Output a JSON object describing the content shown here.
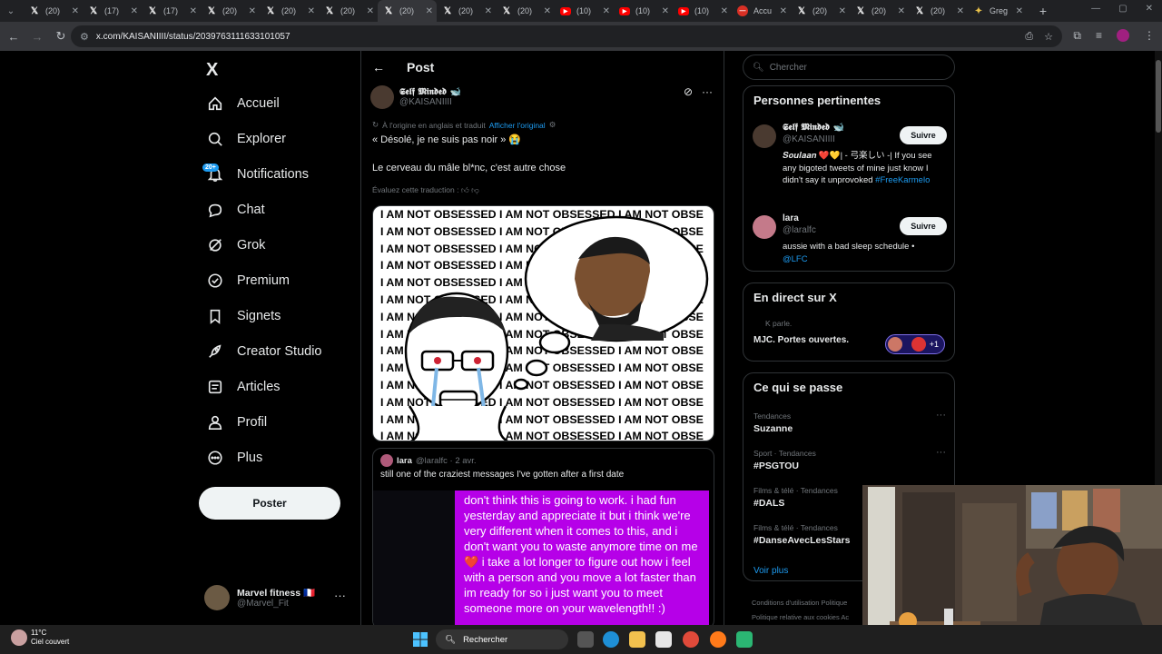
{
  "browser": {
    "tabs": [
      {
        "icon": "x-icon",
        "title": "(20)"
      },
      {
        "icon": "x-icon",
        "title": "(17)"
      },
      {
        "icon": "x-icon",
        "title": "(17)"
      },
      {
        "icon": "x-icon",
        "title": "(20)"
      },
      {
        "icon": "x-icon",
        "title": "(20)"
      },
      {
        "icon": "x-icon",
        "title": "(20)"
      },
      {
        "icon": "x-icon",
        "title": "(20)",
        "active": true
      },
      {
        "icon": "x-icon",
        "title": "(20)"
      },
      {
        "icon": "x-icon",
        "title": "(20)"
      },
      {
        "icon": "youtube-icon",
        "title": "(10)"
      },
      {
        "icon": "youtube-icon",
        "title": "(10)"
      },
      {
        "icon": "youtube-icon",
        "title": "(10)"
      },
      {
        "icon": "stop-icon",
        "title": "Accu"
      },
      {
        "icon": "x-icon",
        "title": "(20)"
      },
      {
        "icon": "x-icon",
        "title": "(20)"
      },
      {
        "icon": "x-icon",
        "title": "(20)"
      },
      {
        "icon": "grok-icon",
        "title": "Greg"
      }
    ],
    "url": "x.com/KAISANIIII/status/2039763111633101057"
  },
  "sidebar": {
    "logo": "X",
    "items": [
      {
        "label": "Accueil",
        "icon": "home-icon"
      },
      {
        "label": "Explorer",
        "icon": "search-icon"
      },
      {
        "label": "Notifications",
        "icon": "bell-icon",
        "badge": "20+"
      },
      {
        "label": "Chat",
        "icon": "chat-icon"
      },
      {
        "label": "Grok",
        "icon": "grok-icon"
      },
      {
        "label": "Premium",
        "icon": "verified-icon"
      },
      {
        "label": "Signets",
        "icon": "bookmark-icon"
      },
      {
        "label": "Creator Studio",
        "icon": "rocket-icon"
      },
      {
        "label": "Articles",
        "icon": "article-icon"
      },
      {
        "label": "Profil",
        "icon": "person-icon"
      },
      {
        "label": "Plus",
        "icon": "more-circle-icon"
      }
    ],
    "post_button": "Poster",
    "account": {
      "name": "Marvel fitness 🇫🇷",
      "handle": "@Marvel_Fit"
    }
  },
  "post": {
    "header": "Post",
    "author_name": "𝕾𝖊𝖑𝖋 𝕸𝖎𝖓𝖉𝖊𝖉 🐋",
    "author_handle": "@KAISANIIII",
    "translated_label": "À l'origine en anglais et traduit",
    "show_original": "Afficher l'original",
    "line1": "« Désolé, je ne suis pas noir » 😭",
    "line2": "Le cerveau du mâle bl*nc, c'est autre chose",
    "evaluate": "Évaluez cette traduction :",
    "meme_rows": [
      "I AM NOT OBSESSED I AM NOT OBSESSED I AM NOT OBSE",
      "I AM NOT OBSESSED I AM NOT OBSESSED I AM NOT OBSE",
      "I AM NOT OBSESSED I AM NOT OBSESSED I AM NOT OBSE",
      "I AM NOT OBSESSED I AM NOT OBSESSED I AM NOT OBSE",
      "I AM NOT OBSESSED I AM NOT OBSESSED I AM NOT OBSE",
      "I AM NOT OBSESSED I AM NOT OBSESSED I AM NOT OBSE",
      "I AM NOT OBSESSED I AM NOT OBSESSED I AM NOT OBSE",
      "I AM NOT OBSESSED I AM NOT OBSESSED I AM NOT OBSE",
      "I AM NOT OBSESSED I AM NOT OBSESSED I AM NOT OBSE",
      "I AM NOT OBSESSED I AM NOT OBSESSED I AM NOT OBSE",
      "I AM NOT OBSESSED I AM NOT OBSESSED I AM NOT OBSE",
      "I AM NOT OBSESSED I AM NOT OBSESSED I AM NOT OBSE",
      "I AM NOT OBSESSED I AM NOT OBSESSED I AM NOT OBSE",
      "I AM NOT OBSESSED I AM NOT OBSESSED I AM NOT OBSE"
    ],
    "quote": {
      "name": "lara",
      "handle": "@laralfc · 2 avr.",
      "text": "still one of the craziest messages I've gotten after a first date",
      "message": "don't think this is going to work. i had fun yesterday and appreciate it but i think we're very different when it comes to this, and i don't want you to waste anymore time on me❤️ i take a lot longer to figure out how i feel with a person and you move a lot faster than im ready for so i just want you to meet someone more on your wavelength!! :)"
    }
  },
  "right": {
    "search_placeholder": "Chercher",
    "relevant_title": "Personnes pertinentes",
    "people": [
      {
        "name": "𝕾𝖊𝖑𝖋 𝕸𝖎𝖓𝖉𝖊𝖉 🐋",
        "handle": "@KAISANIIII",
        "bio": "𝑺𝒐𝒖𝒍𝒂𝒂𝒏 ❤️💛| - 弓楽しい -| If you see any bigoted tweets of mine just know I didn't say it unprovoked",
        "tag": "#FreeKarmelo",
        "follow": "Suivre"
      },
      {
        "name": "lara",
        "handle": "@laralfc",
        "bio": "aussie with a bad sleep schedule •",
        "tag": "@LFC",
        "follow": "Suivre"
      }
    ],
    "live_title": "En direct sur X",
    "live_speaker": "K parle.",
    "live_name": "MJC.  Portes ouvertes.",
    "live_more": "+1",
    "trends_title": "Ce qui se passe",
    "trends": [
      {
        "category": "Tendances",
        "name": "Suzanne"
      },
      {
        "category": "Sport · Tendances",
        "name": "#PSGTOU"
      },
      {
        "category": "Films & télé · Tendances",
        "name": "#DALS"
      },
      {
        "category": "Films & télé · Tendances",
        "name": "#DanseAvecLesStars"
      }
    ],
    "show_more": "Voir plus",
    "footer1": "Conditions d'utilisation   Politique",
    "footer2": "Politique relative aux cookies   Ac"
  },
  "taskbar": {
    "temp": "11°C",
    "weather": "Ciel couvert",
    "search": "Rechercher"
  }
}
